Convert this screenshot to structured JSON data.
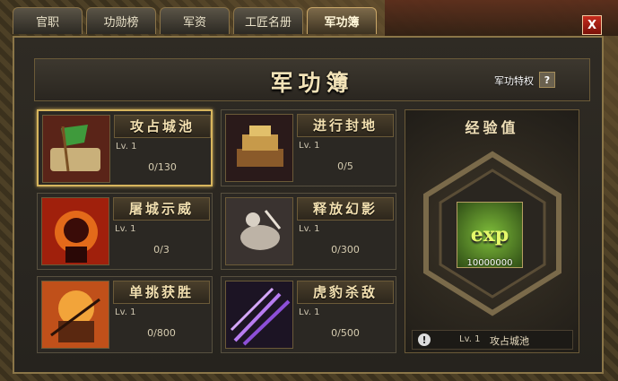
{
  "tabs": [
    "官职",
    "功勋榜",
    "军资",
    "工匠名册",
    "军功簿"
  ],
  "active_tab": "军功簿",
  "close_label": "X",
  "header": {
    "title": "军功簿",
    "privilege_label": "军功特权",
    "help_label": "?"
  },
  "achievements": [
    {
      "name": "攻占城池",
      "level": "Lv. 1",
      "progress": "0/130",
      "icon": "captured-city-icon"
    },
    {
      "name": "进行封地",
      "level": "Lv. 1",
      "progress": "0/5",
      "icon": "seal-chest-icon"
    },
    {
      "name": "屠城示威",
      "level": "Lv. 1",
      "progress": "0/3",
      "icon": "massacre-icon"
    },
    {
      "name": "释放幻影",
      "level": "Lv. 1",
      "progress": "0/300",
      "icon": "phantom-rider-icon"
    },
    {
      "name": "单挑获胜",
      "level": "Lv. 1",
      "progress": "0/800",
      "icon": "duel-icon"
    },
    {
      "name": "虎豹杀敌",
      "level": "Lv. 1",
      "progress": "0/500",
      "icon": "arrows-icon"
    }
  ],
  "exp": {
    "title": "经验值",
    "icon_text": "exp",
    "value": "10000000",
    "footer_level": "Lv. 1",
    "footer_name": "攻占城池"
  }
}
